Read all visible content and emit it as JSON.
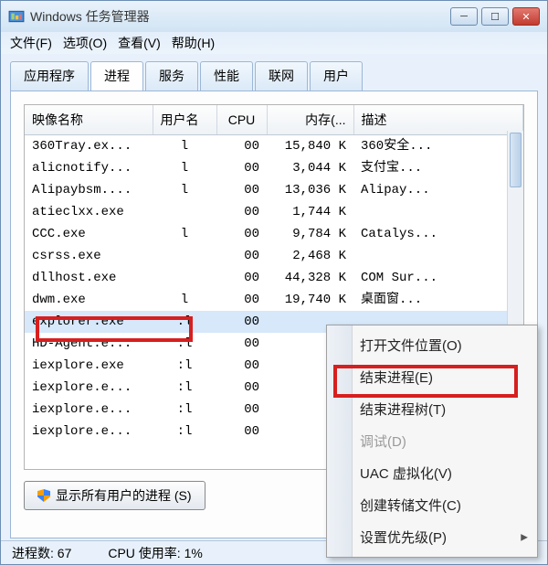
{
  "window": {
    "title": "Windows 任务管理器"
  },
  "menu": {
    "file": "文件(F)",
    "options": "选项(O)",
    "view": "查看(V)",
    "help": "帮助(H)"
  },
  "tabs": {
    "apps": "应用程序",
    "processes": "进程",
    "services": "服务",
    "performance": "性能",
    "network": "联网",
    "users": "用户"
  },
  "columns": {
    "image": "映像名称",
    "user": "用户名",
    "cpu": "CPU",
    "memory": "内存(...",
    "desc": "描述"
  },
  "rows": [
    {
      "image": "360Tray.ex...",
      "user": "l",
      "cpu": "00",
      "mem": "15,840 K",
      "desc": "360安全..."
    },
    {
      "image": "alicnotify...",
      "user": "l",
      "cpu": "00",
      "mem": "3,044 K",
      "desc": "支付宝..."
    },
    {
      "image": "Alipaybsm....",
      "user": "l",
      "cpu": "00",
      "mem": "13,036 K",
      "desc": "Alipay..."
    },
    {
      "image": "atieclxx.exe",
      "user": "",
      "cpu": "00",
      "mem": "1,744 K",
      "desc": ""
    },
    {
      "image": "CCC.exe",
      "user": "l",
      "cpu": "00",
      "mem": "9,784 K",
      "desc": "Catalys..."
    },
    {
      "image": "csrss.exe",
      "user": "",
      "cpu": "00",
      "mem": "2,468 K",
      "desc": ""
    },
    {
      "image": "dllhost.exe",
      "user": "",
      "cpu": "00",
      "mem": "44,328 K",
      "desc": "COM Sur..."
    },
    {
      "image": "dwm.exe",
      "user": "l",
      "cpu": "00",
      "mem": "19,740 K",
      "desc": "桌面窗..."
    },
    {
      "image": "explorer.exe",
      "user": ":l",
      "cpu": "00",
      "mem": "",
      "desc": ""
    },
    {
      "image": "HD-Agent.e...",
      "user": ":l",
      "cpu": "00",
      "mem": "",
      "desc": ""
    },
    {
      "image": "iexplore.exe",
      "user": ":l",
      "cpu": "00",
      "mem": "",
      "desc": ""
    },
    {
      "image": "iexplore.e...",
      "user": ":l",
      "cpu": "00",
      "mem": "",
      "desc": ""
    },
    {
      "image": "iexplore.e...",
      "user": ":l",
      "cpu": "00",
      "mem": "",
      "desc": ""
    },
    {
      "image": "iexplore.e...",
      "user": ":l",
      "cpu": "00",
      "mem": "",
      "desc": ""
    }
  ],
  "selected_row_index": 8,
  "footer_button": "显示所有用户的进程 (S)",
  "status": {
    "process_count": "进程数: 67",
    "cpu_usage": "CPU 使用率: 1%"
  },
  "context_menu": {
    "open_location": "打开文件位置(O)",
    "end_process": "结束进程(E)",
    "end_tree": "结束进程树(T)",
    "debug": "调试(D)",
    "uac_virt": "UAC 虚拟化(V)",
    "create_dump": "创建转储文件(C)",
    "set_priority": "设置优先级(P)"
  }
}
